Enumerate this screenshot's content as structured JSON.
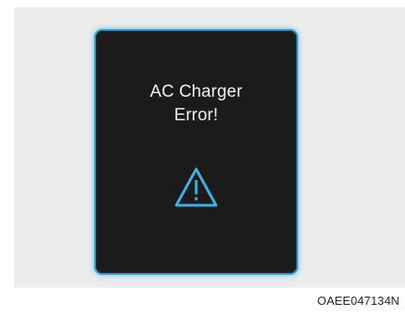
{
  "display": {
    "message_line1": "AC Charger",
    "message_line2": "Error!",
    "icon": "warning-triangle-icon",
    "border_color": "#3aa0d0",
    "icon_color": "#3fb0e0",
    "background_color": "#1b1b1b"
  },
  "figure_code": "OAEE047134N"
}
